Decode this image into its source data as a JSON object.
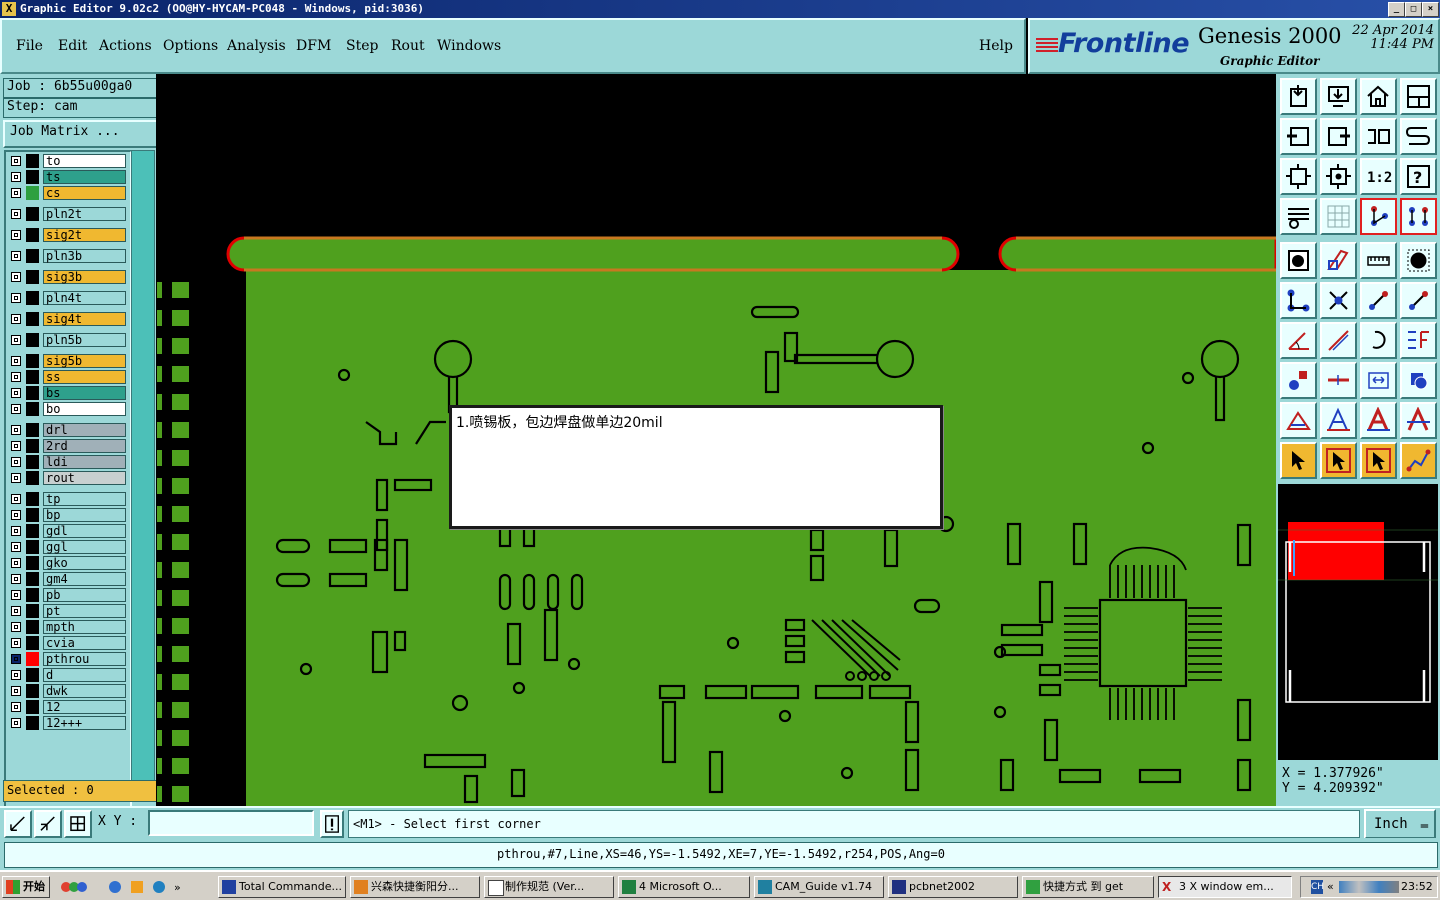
{
  "window": {
    "title": "Graphic Editor 9.02c2  (OO@HY-HYCAM-PC048 - Windows, pid:3036)",
    "btn_min": "_",
    "btn_max": "□",
    "btn_close": "×"
  },
  "menu": [
    "File",
    "Edit",
    "Actions",
    "Options",
    "Analysis",
    "DFM",
    "Step",
    "Rout",
    "Windows"
  ],
  "help_label": "Help",
  "brand": {
    "logo": "Frontline",
    "product": "Genesis 2000",
    "subtitle": "Graphic Editor",
    "date": "22 Apr 2014",
    "time": "11:44 PM"
  },
  "job": {
    "job_text": "Job : 6b55u00ga0",
    "step_text": "Step: cam",
    "job_matrix": "Job Matrix ..."
  },
  "layers": [
    {
      "name": "to",
      "color": "#ffffff",
      "active": false
    },
    {
      "name": "ts",
      "color": "#2ea08c",
      "active": false
    },
    {
      "name": "cs",
      "color": "#f0b830",
      "active": true
    },
    {
      "name": "pln2t",
      "color": "#9cd8d8",
      "active": false
    },
    {
      "name": "sig2t",
      "color": "#f0b830",
      "active": false
    },
    {
      "name": "pln3b",
      "color": "#9cd8d8",
      "active": false
    },
    {
      "name": "sig3b",
      "color": "#f0b830",
      "active": false
    },
    {
      "name": "pln4t",
      "color": "#9cd8d8",
      "active": false
    },
    {
      "name": "sig4t",
      "color": "#f0b830",
      "active": false
    },
    {
      "name": "pln5b",
      "color": "#9cd8d8",
      "active": false
    },
    {
      "name": "sig5b",
      "color": "#f0b830",
      "active": false
    },
    {
      "name": "ss",
      "color": "#f0b830",
      "active": false
    },
    {
      "name": "bs",
      "color": "#2ea08c",
      "active": false
    },
    {
      "name": "bo",
      "color": "#ffffff",
      "active": false
    },
    {
      "name": "drl",
      "color": "#a0b0b8",
      "active": false
    },
    {
      "name": "2rd",
      "color": "#a0b0b8",
      "active": false
    },
    {
      "name": "ldi",
      "color": "#a0b0b8",
      "active": false
    },
    {
      "name": "rout",
      "color": "#c8d0d0",
      "active": false
    },
    {
      "name": "tp",
      "color": "#9cd8d8",
      "active": false
    },
    {
      "name": "bp",
      "color": "#9cd8d8",
      "active": false
    },
    {
      "name": "gdl",
      "color": "#9cd8d8",
      "active": false
    },
    {
      "name": "ggl",
      "color": "#9cd8d8",
      "active": false
    },
    {
      "name": "gko",
      "color": "#9cd8d8",
      "active": false
    },
    {
      "name": "gm4",
      "color": "#9cd8d8",
      "active": false
    },
    {
      "name": "pb",
      "color": "#9cd8d8",
      "active": false
    },
    {
      "name": "pt",
      "color": "#9cd8d8",
      "active": false
    },
    {
      "name": "mpth",
      "color": "#9cd8d8",
      "active": false
    },
    {
      "name": "cvia",
      "color": "#9cd8d8",
      "active": false
    },
    {
      "name": "pthrou",
      "color": "#9cd8d8",
      "active": false,
      "working": true
    },
    {
      "name": "d",
      "color": "#9cd8d8",
      "active": false
    },
    {
      "name": "dwk",
      "color": "#9cd8d8",
      "active": false
    },
    {
      "name": "12",
      "color": "#9cd8d8",
      "active": false
    },
    {
      "name": "12+++",
      "color": "#9cd8d8",
      "active": false
    }
  ],
  "selected_text": "Selected : 0",
  "note_text": "1.喷锡板，包边焊盘做单边20mil",
  "coords": {
    "x": "X = 1.377926\"",
    "y": "Y = 4.209392\""
  },
  "cmd": {
    "xy_label": "X Y :",
    "xy_value": "",
    "prompt": "<M1> - Select first corner",
    "units": "Inch"
  },
  "status_line": "pthrou,#7,Line,XS=46,YS=-1.5492,XE=7,YE=-1.5492,r254,POS,Ang=0",
  "taskbar": {
    "start": "开始",
    "tasks": [
      "Total Commande...",
      "兴森快捷衡阳分...",
      "制作规范 (Ver...",
      "4 Microsoft O...",
      "CAM_Guide v1.74",
      "pcbnet2002",
      "快捷方式 到 get",
      "3 X window em..."
    ],
    "clock": "23:52",
    "tray_lang": "CH"
  },
  "colors": {
    "panel": "#9cd8d8",
    "board": "#4fa01e",
    "copper_outline": "#000000",
    "highlight": "#ff0000"
  }
}
